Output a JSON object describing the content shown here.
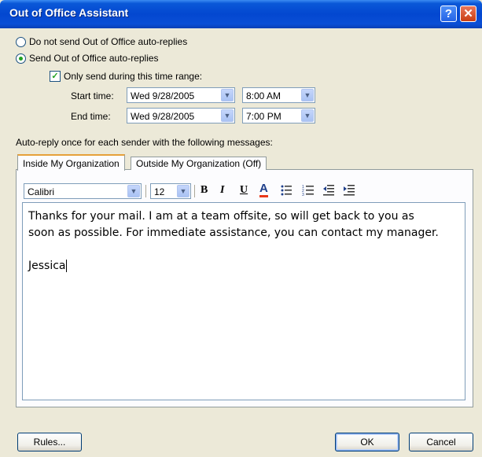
{
  "window": {
    "title": "Out of Office Assistant",
    "help_glyph": "?",
    "close_glyph": "✕"
  },
  "options": {
    "no_send_label": "Do not send Out of Office auto-replies",
    "send_label": "Send Out of Office auto-replies",
    "selected": "send",
    "time_range_label": "Only send during this time range:",
    "time_range_checked": true
  },
  "start": {
    "label": "Start time:",
    "date": "Wed 9/28/2005",
    "time": "8:00 AM"
  },
  "end": {
    "label": "End time:",
    "date": "Wed 9/28/2005",
    "time": "7:00 PM"
  },
  "messages_label": "Auto-reply once for each sender with the following messages:",
  "tabs": [
    {
      "label": "Inside My Organization",
      "active": true
    },
    {
      "label": "Outside My Organization (Off)",
      "active": false
    }
  ],
  "format": {
    "font": "Calibri",
    "size": "12",
    "bold": "B",
    "italic": "I",
    "underline": "U",
    "font_color": "A",
    "font_color_hex": "#e8381a"
  },
  "message": {
    "lines": [
      "Thanks for your mail. I am at a team offsite, so will get back to you as",
      "soon as possible. For immediate assistance, you can contact my manager."
    ],
    "signature": "Jessica"
  },
  "buttons": {
    "rules": "Rules...",
    "ok": "OK",
    "cancel": "Cancel"
  }
}
